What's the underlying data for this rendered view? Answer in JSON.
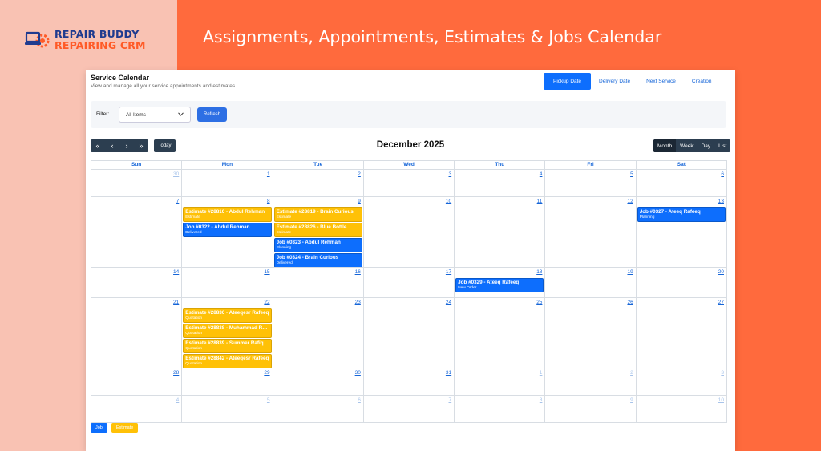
{
  "brand": {
    "line1": "REPAIR BUDDY",
    "line2": "REPAIRING CRM",
    "accent": "#ff6a3d",
    "navy": "#1f3b8f"
  },
  "headline": "Assignments, Appointments, Estimates & Jobs Calendar",
  "panel": {
    "title": "Service Calendar",
    "subtitle": "View and manage all your service appointments and estimates",
    "tabs": [
      {
        "label": "Pickup Date",
        "active": true
      },
      {
        "label": "Delivery Date",
        "active": false
      },
      {
        "label": "Next Service",
        "active": false
      },
      {
        "label": "Creation",
        "active": false
      }
    ]
  },
  "filter": {
    "label": "Filter:",
    "selected": "All Items",
    "refresh_label": "Refresh"
  },
  "toolbar": {
    "nav": [
      "«",
      "‹",
      "›",
      "»"
    ],
    "today_label": "Today",
    "month_title": "December 2025",
    "views": [
      {
        "label": "Month",
        "active": true
      },
      {
        "label": "Week",
        "active": false
      },
      {
        "label": "Day",
        "active": false
      },
      {
        "label": "List",
        "active": false
      }
    ]
  },
  "calendar": {
    "weekdays": [
      "Sun",
      "Mon",
      "Tue",
      "Wed",
      "Thu",
      "Fri",
      "Sat"
    ],
    "weeks": [
      {
        "height": 34,
        "days": [
          {
            "num": "30",
            "other": true,
            "events": []
          },
          {
            "num": "1",
            "events": []
          },
          {
            "num": "2",
            "events": []
          },
          {
            "num": "3",
            "events": []
          },
          {
            "num": "4",
            "events": []
          },
          {
            "num": "5",
            "events": []
          },
          {
            "num": "6",
            "events": []
          }
        ]
      },
      {
        "height": 88,
        "days": [
          {
            "num": "7",
            "events": []
          },
          {
            "num": "8",
            "events": [
              {
                "type": "est",
                "title": "Estimate #28810 - Abdul Rehman",
                "sub": "Estimate"
              },
              {
                "type": "job",
                "title": "Job #0322 - Abdul Rehman",
                "sub": "Delivered"
              }
            ]
          },
          {
            "num": "9",
            "events": [
              {
                "type": "est",
                "title": "Estimate #28819 - Brain Curious",
                "sub": "Estimate"
              },
              {
                "type": "est",
                "title": "Estimate #28826 - Blue Bottle",
                "sub": "Estimate"
              },
              {
                "type": "job",
                "title": "Job #0323 - Abdul Rehman",
                "sub": "Planning"
              },
              {
                "type": "job",
                "title": "Job #0324 - Brain Curious",
                "sub": "Delivered"
              }
            ]
          },
          {
            "num": "10",
            "events": []
          },
          {
            "num": "11",
            "events": []
          },
          {
            "num": "12",
            "events": []
          },
          {
            "num": "13",
            "events": [
              {
                "type": "job",
                "title": "Job #0327 - Ateeq Rafeeq",
                "sub": "Planning"
              }
            ]
          }
        ]
      },
      {
        "height": 38,
        "days": [
          {
            "num": "14",
            "events": []
          },
          {
            "num": "15",
            "events": []
          },
          {
            "num": "16",
            "events": []
          },
          {
            "num": "17",
            "events": []
          },
          {
            "num": "18",
            "events": [
              {
                "type": "job",
                "title": "Job #0329 - Ateeq Rafeeq",
                "sub": "New Order"
              }
            ]
          },
          {
            "num": "19",
            "events": []
          },
          {
            "num": "20",
            "events": []
          }
        ]
      },
      {
        "height": 88,
        "days": [
          {
            "num": "21",
            "events": []
          },
          {
            "num": "22",
            "events": [
              {
                "type": "est",
                "title": "Estimate #28836 - Ateeqesr Rafeeq",
                "sub": "Quotation"
              },
              {
                "type": "est",
                "title": "Estimate #28838 - Muhammad Ra...",
                "sub": "Quotation"
              },
              {
                "type": "est",
                "title": "Estimate #28839 - Summer Rafique",
                "sub": "Quotation"
              },
              {
                "type": "est",
                "title": "Estimate #28842 - Ateeqesr Rafeeq",
                "sub": "Quotation"
              }
            ]
          },
          {
            "num": "23",
            "events": []
          },
          {
            "num": "24",
            "events": []
          },
          {
            "num": "25",
            "events": []
          },
          {
            "num": "26",
            "events": []
          },
          {
            "num": "27",
            "events": []
          }
        ]
      },
      {
        "height": 34,
        "days": [
          {
            "num": "28",
            "events": []
          },
          {
            "num": "29",
            "events": []
          },
          {
            "num": "30",
            "events": []
          },
          {
            "num": "31",
            "events": []
          },
          {
            "num": "1",
            "other": true,
            "events": []
          },
          {
            "num": "2",
            "other": true,
            "events": []
          },
          {
            "num": "3",
            "other": true,
            "events": []
          }
        ]
      },
      {
        "height": 34,
        "days": [
          {
            "num": "4",
            "other": true,
            "events": []
          },
          {
            "num": "5",
            "other": true,
            "events": []
          },
          {
            "num": "6",
            "other": true,
            "events": []
          },
          {
            "num": "7",
            "other": true,
            "events": []
          },
          {
            "num": "8",
            "other": true,
            "events": []
          },
          {
            "num": "9",
            "other": true,
            "events": []
          },
          {
            "num": "10",
            "other": true,
            "events": []
          }
        ]
      }
    ]
  },
  "legend": {
    "job_label": "Job",
    "estimate_label": "Estimate"
  }
}
